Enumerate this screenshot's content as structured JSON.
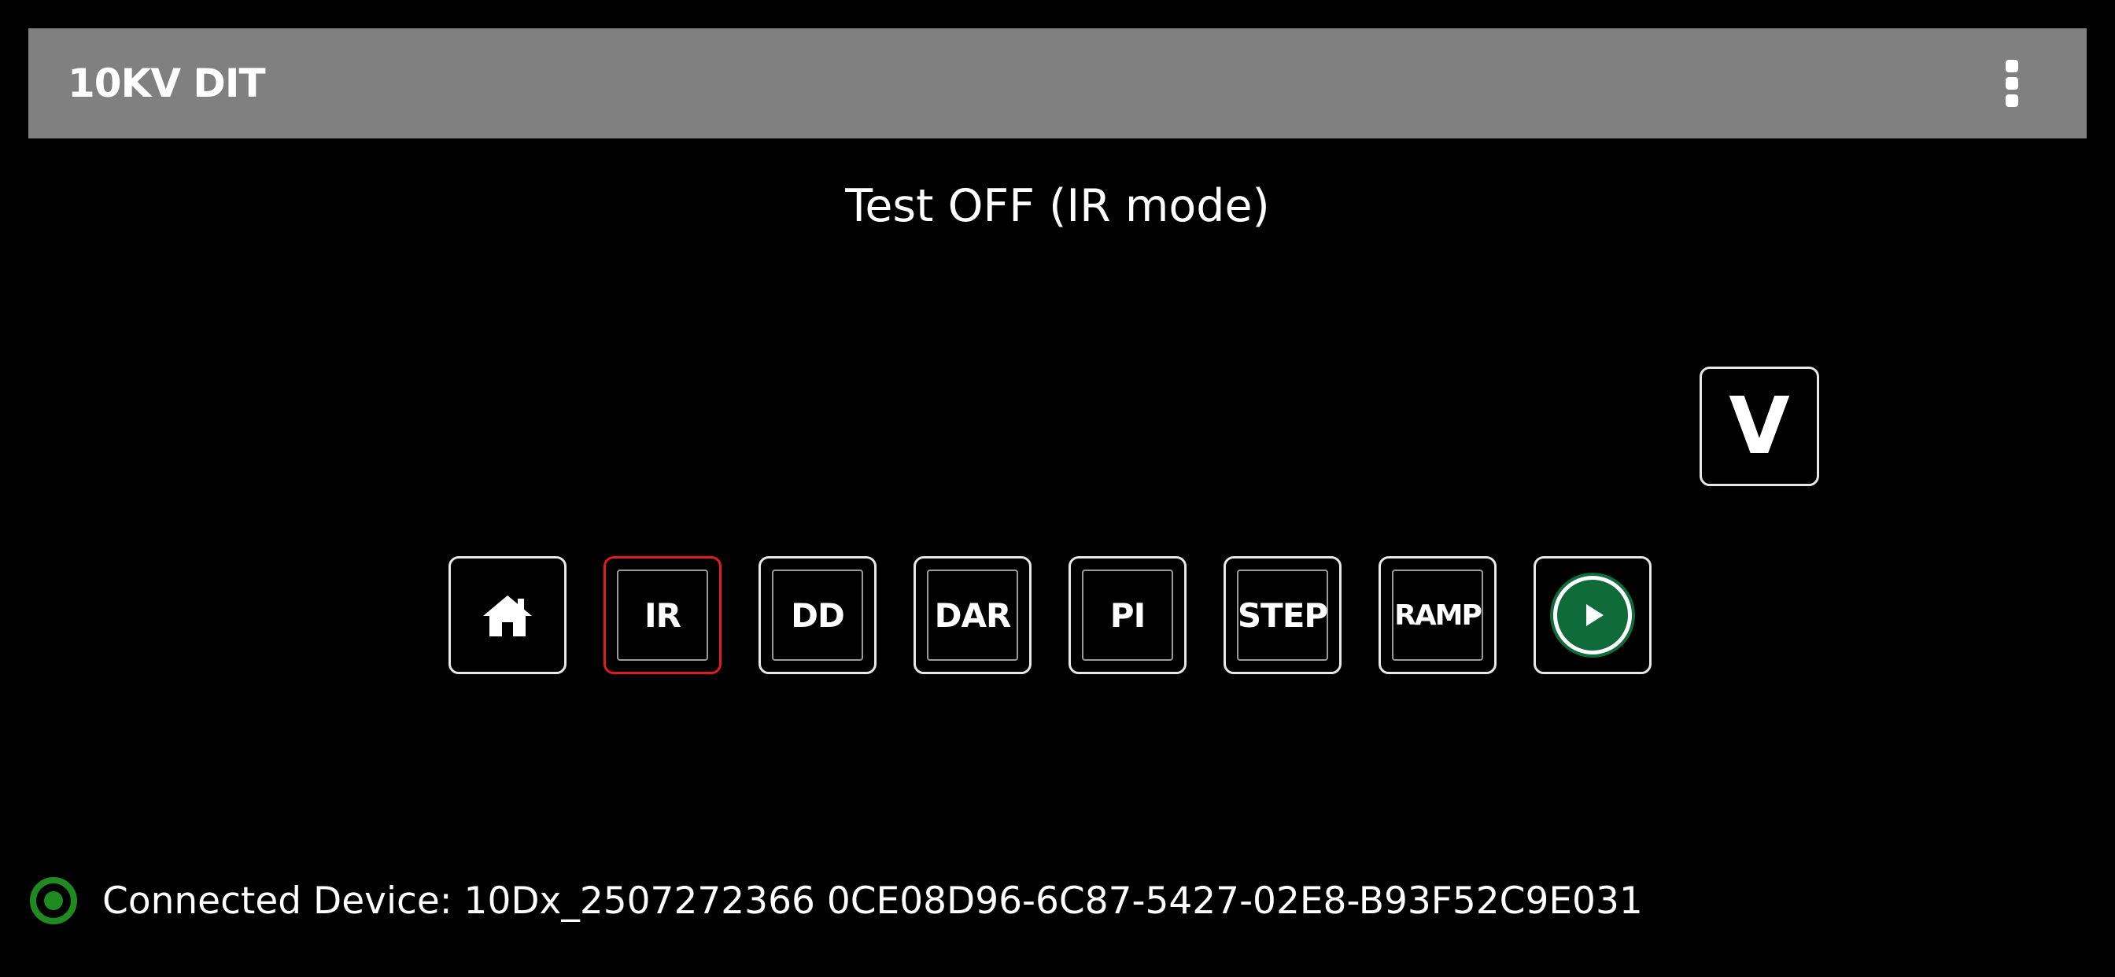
{
  "app": {
    "title": "10KV DIT",
    "menu_icon": "more-vert-icon"
  },
  "status": {
    "text": "Test OFF  (IR mode)"
  },
  "voltage_button": {
    "label": "V"
  },
  "mode_buttons": [
    {
      "name": "home",
      "icon": "home-icon",
      "label": ""
    },
    {
      "name": "ir",
      "label": "IR",
      "selected": true
    },
    {
      "name": "dd",
      "label": "DD"
    },
    {
      "name": "dar",
      "label": "DAR"
    },
    {
      "name": "pi",
      "label": "PI"
    },
    {
      "name": "step",
      "label": "STEP"
    },
    {
      "name": "ramp",
      "label": "RAMP"
    },
    {
      "name": "start",
      "icon": "play-icon",
      "label": ""
    }
  ],
  "footer": {
    "connection_icon": "radio-connected-icon",
    "connected_text": "Connected Device: 10Dx_2507272366 0CE08D96-6C87-5427-02E8-B93F52C9E031"
  },
  "colors": {
    "appbar_bg": "#808080",
    "background": "#000000",
    "selected_border": "#e31b1b",
    "play_green": "#0f6b3a",
    "connection_green": "#1f8a1f"
  }
}
